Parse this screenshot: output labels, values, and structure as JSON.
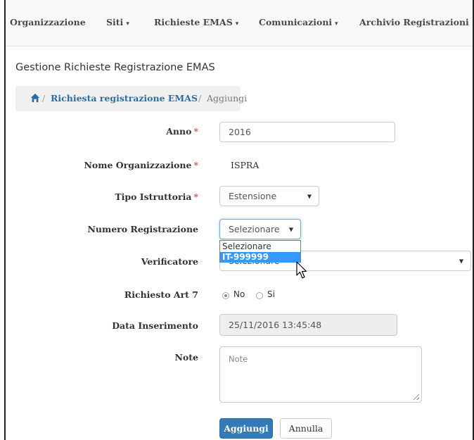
{
  "navbar": {
    "items": [
      {
        "label": "Organizzazione",
        "caret": false
      },
      {
        "label": "Siti",
        "caret": true
      },
      {
        "label": "Richieste EMAS",
        "caret": true
      },
      {
        "label": "Comunicazioni",
        "caret": true
      },
      {
        "label": "Archivio Registrazioni",
        "caret": false
      }
    ],
    "caret_glyph": "▾"
  },
  "page_title": "Gestione Richieste Registrazione EMAS",
  "breadcrumb": {
    "home_icon": "home-icon",
    "separator": "/",
    "link": "Richiesta registrazione EMAS",
    "active": "Aggiungi"
  },
  "form": {
    "required_mark": "*",
    "anno": {
      "label": "Anno",
      "value": "2016"
    },
    "nome_organizzazione": {
      "label": "Nome Organizzazione",
      "value": "ISPRA"
    },
    "tipo_istruttoria": {
      "label": "Tipo Istruttoria",
      "value": "Estensione"
    },
    "numero_registrazione": {
      "label": "Numero Registrazione",
      "value": "Selezionare",
      "options": [
        "Selezionare",
        "IT-999999"
      ],
      "highlighted_option": "IT-999999"
    },
    "verificatore": {
      "label": "Verificatore",
      "value": "Selezionare"
    },
    "richiesto_art7": {
      "label": "Richiesto Art 7",
      "options": [
        "No",
        "Si"
      ],
      "selected": "No"
    },
    "data_inserimento": {
      "label": "Data Inserimento",
      "value": "25/11/2016 13:45:48"
    },
    "note": {
      "label": "Note",
      "placeholder": "Note"
    }
  },
  "buttons": {
    "submit": "Aggiungi",
    "cancel": "Annulla"
  },
  "colors": {
    "primary": "#337ab7",
    "link": "#2e6da4",
    "required": "#d9534f",
    "highlight": "#3399ff"
  }
}
